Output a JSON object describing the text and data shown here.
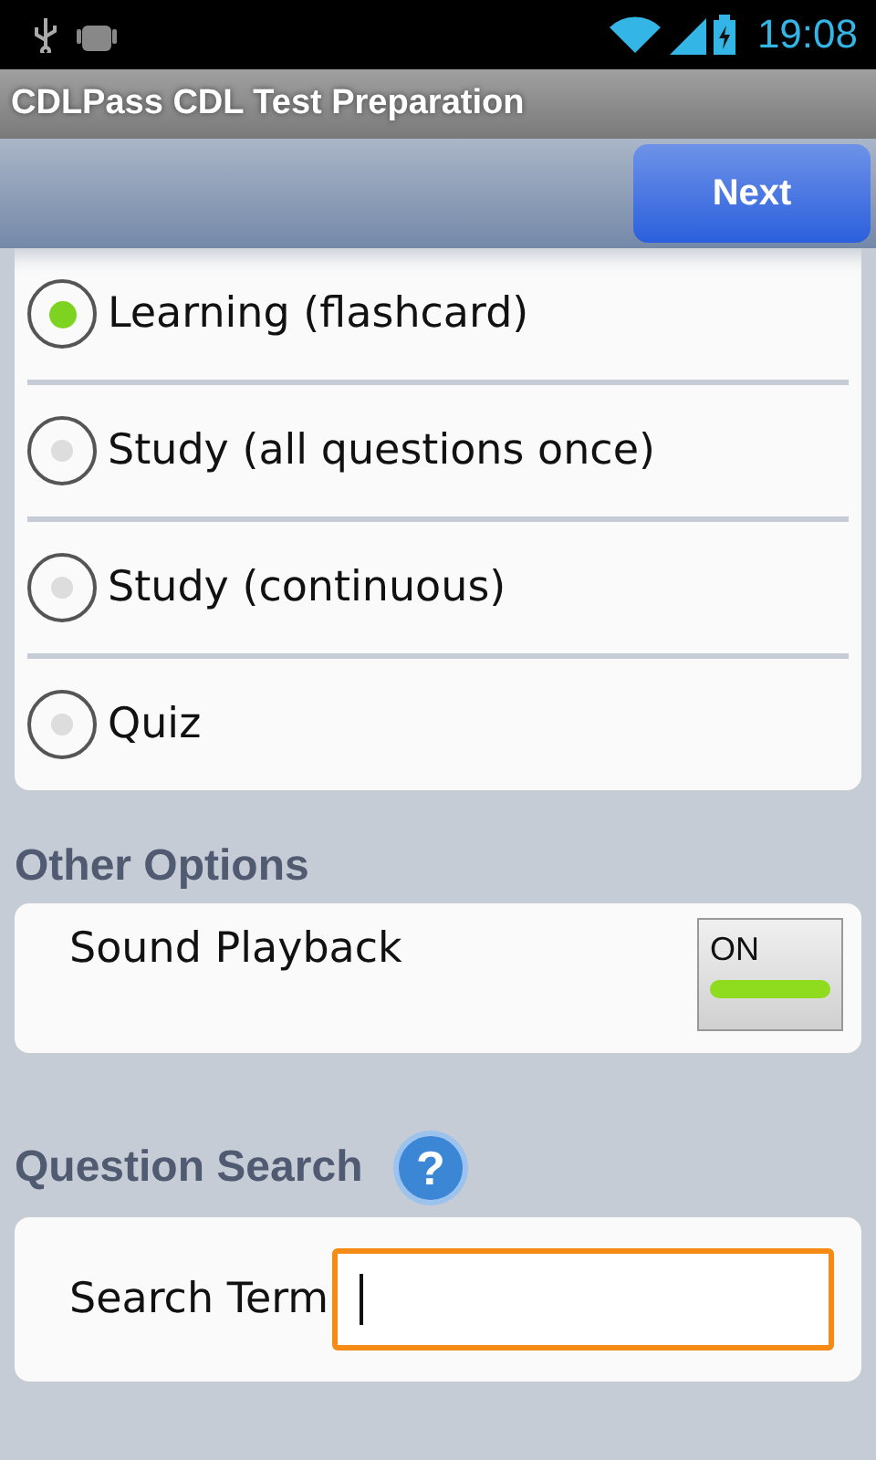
{
  "status_bar": {
    "time": "19:08"
  },
  "window": {
    "title": "CDLPass CDL Test Preparation"
  },
  "toolbar": {
    "next_button": "Next"
  },
  "modes": [
    {
      "label": "Learning (flashcard)",
      "selected": true
    },
    {
      "label": "Study (all questions once)",
      "selected": false
    },
    {
      "label": "Study (continuous)",
      "selected": false
    },
    {
      "label": "Quiz",
      "selected": false
    }
  ],
  "other_options": {
    "heading": "Other Options",
    "sound": {
      "label": "Sound Playback",
      "toggle_text": "ON",
      "on": true
    }
  },
  "question_search": {
    "heading": "Question Search",
    "help_button": "?",
    "field_label": "Search Term",
    "focused": true
  }
}
